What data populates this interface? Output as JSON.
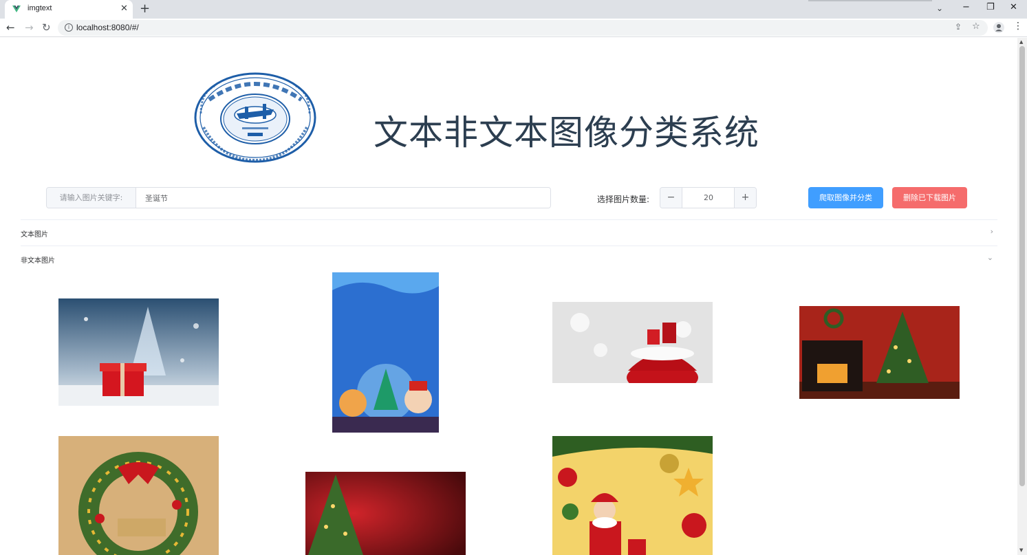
{
  "browser": {
    "tab_title": "imgtext",
    "tab_close": "✕",
    "new_tab": "+",
    "tab_search": "⌄",
    "window_controls": {
      "minimize": "−",
      "maximize": "❐",
      "close": "✕"
    },
    "nav": {
      "back": "←",
      "forward": "→",
      "reload": "↻"
    },
    "url": "localhost:8080/#/",
    "info_icon": "i",
    "share_icon": "⇪",
    "star_icon": "☆",
    "menu_icon": "⋮"
  },
  "page": {
    "title": "文本非文本图像分类系统",
    "logo": {
      "name": "华中科技大学",
      "motto": "明德厚学 求是创新",
      "ring_text": "HUAZHONG UNIVERSITY OF SCIENCE AND TECHNOLOGY",
      "monogram": "HUST",
      "subtext": "WUHAN CHINA"
    }
  },
  "search": {
    "prepend_label": "请输入图片关键字:",
    "keyword_value": "圣诞节"
  },
  "count": {
    "label": "选择图片数量:",
    "value": "20",
    "minus": "−",
    "plus": "+"
  },
  "buttons": {
    "crawl": "爬取图像并分类",
    "delete": "删除已下载图片"
  },
  "collapse": [
    {
      "title": "文本图片",
      "arrow": "›"
    },
    {
      "title": "非文本图片",
      "arrow": "⌄"
    }
  ],
  "gallery": {
    "images": [
      "christmas-tree-gift-snow",
      "cartoon-santa-snowglobe",
      "santa-gift-sack",
      "fireplace-christmas-tree",
      "christmas-wreath",
      "christmas-tree-red-background",
      "santa-ornaments"
    ]
  },
  "colors": {
    "primary": "#409eff",
    "danger": "#f56c6c",
    "title": "#2c3e50",
    "logo_blue": "#1e5ea8"
  }
}
